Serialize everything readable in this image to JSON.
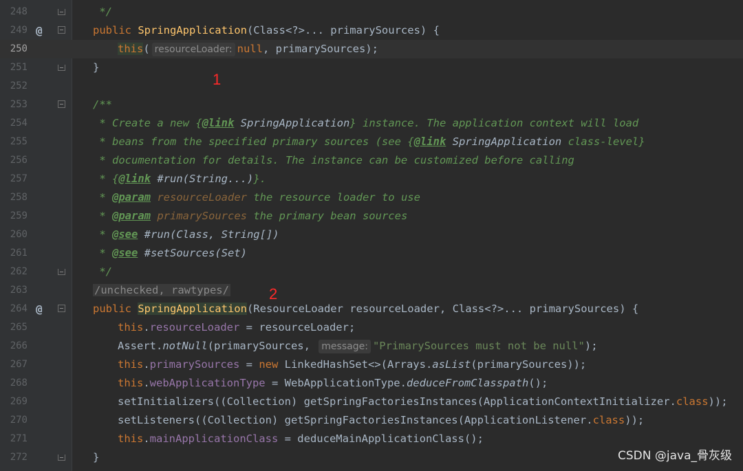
{
  "editor": {
    "lines": [
      {
        "num": "248",
        "text": " */"
      },
      {
        "num": "249",
        "text": ""
      },
      {
        "num": "250",
        "text": ""
      },
      {
        "num": "251",
        "text": "}"
      },
      {
        "num": "252",
        "text": ""
      },
      {
        "num": "253",
        "text": "/**"
      },
      {
        "num": "254",
        "text": ""
      },
      {
        "num": "255",
        "text": ""
      },
      {
        "num": "256",
        "text": " * documentation for details. The instance can be customized before calling"
      },
      {
        "num": "257",
        "text": ""
      },
      {
        "num": "258",
        "text": ""
      },
      {
        "num": "259",
        "text": ""
      },
      {
        "num": "260",
        "text": ""
      },
      {
        "num": "261",
        "text": ""
      },
      {
        "num": "262",
        "text": " */"
      },
      {
        "num": "263",
        "text": "/unchecked, rawtypes/"
      },
      {
        "num": "264",
        "text": ""
      },
      {
        "num": "265",
        "text": ""
      },
      {
        "num": "266",
        "text": ""
      },
      {
        "num": "267",
        "text": ""
      },
      {
        "num": "268",
        "text": ""
      },
      {
        "num": "269",
        "text": ""
      },
      {
        "num": "270",
        "text": ""
      },
      {
        "num": "271",
        "text": ""
      },
      {
        "num": "272",
        "text": "}"
      }
    ],
    "gutter_symbol": "@",
    "tokens": {
      "public": "public ",
      "class_name": "SpringApplication",
      "sig1_rest": "(Class<?>... primarySources) {",
      "this_kw": "this",
      "paren_open": "(",
      "hint_resource_loader": "resourceLoader:",
      "null_kw": "null",
      "line250_rest": ", primarySources);",
      "l254_a": " * Create a new ",
      "l254_open": "{",
      "link_tag": "@link",
      "l254_ref": " SpringApplication",
      "l254_close": "}",
      "l254_b": " instance. The application context will load",
      "l255_a": " * beans from the specified primary sources (see ",
      "l255_open": "{",
      "l255_ref": " SpringApplication",
      "l255_b": " class-level}",
      "l257_a": " * ",
      "l257_open": "{",
      "l257_ref": " #run(String...)",
      "l257_close": "}.",
      "param_tag": "@param",
      "see_tag": "@see",
      "l258_name": " resourceLoader",
      "l258_b": " the resource loader to use",
      "l259_name": " primarySources",
      "l259_b": " the primary bean sources",
      "l260_ref": " #run(Class, String[])",
      "l261_ref": " #setSources(Set)",
      "star": " * ",
      "sig2_rest": "(ResourceLoader resourceLoader, Class<?>... primarySources) {",
      "dot": ".",
      "field_resource_loader": "resourceLoader",
      "assign_resource_loader": " = resourceLoader;",
      "assert_prefix": "Assert.",
      "not_null": "notNull",
      "assert_arg": "(primarySources, ",
      "hint_message": "message:",
      "assert_str": "\"PrimarySources must not be null\"",
      "assert_end": ");",
      "field_primary_sources": "primarySources",
      "assign_eq": " = ",
      "new_kw": "new",
      "linked_hash": " LinkedHashSet<>(Arrays.",
      "as_list": "asList",
      "l267_end": "(primarySources));",
      "field_web_type": "webApplicationType",
      "web_type_prefix": " = WebApplicationType.",
      "deduce_from": "deduceFromClasspath",
      "call_end": "();",
      "l269_a": "setInitializers((Collection) getSpringFactoriesInstances(ApplicationContextInitializer.",
      "class_kw": "class",
      "l269_end": "));",
      "l270_a": "setListeners((Collection) getSpringFactoriesInstances(ApplicationListener.",
      "field_main_class": "mainApplicationClass",
      "l271_rest": " = deduceMainApplicationClass();"
    }
  },
  "markers": {
    "one": "1",
    "two": "2"
  },
  "watermark": "CSDN @java_骨灰级",
  "colors": {
    "background": "#2b2b2b",
    "keyword": "#cc7832",
    "method": "#ffc66d",
    "field": "#9876aa",
    "string": "#6a8759",
    "comment": "#629755",
    "marker": "#ff2a2a"
  }
}
